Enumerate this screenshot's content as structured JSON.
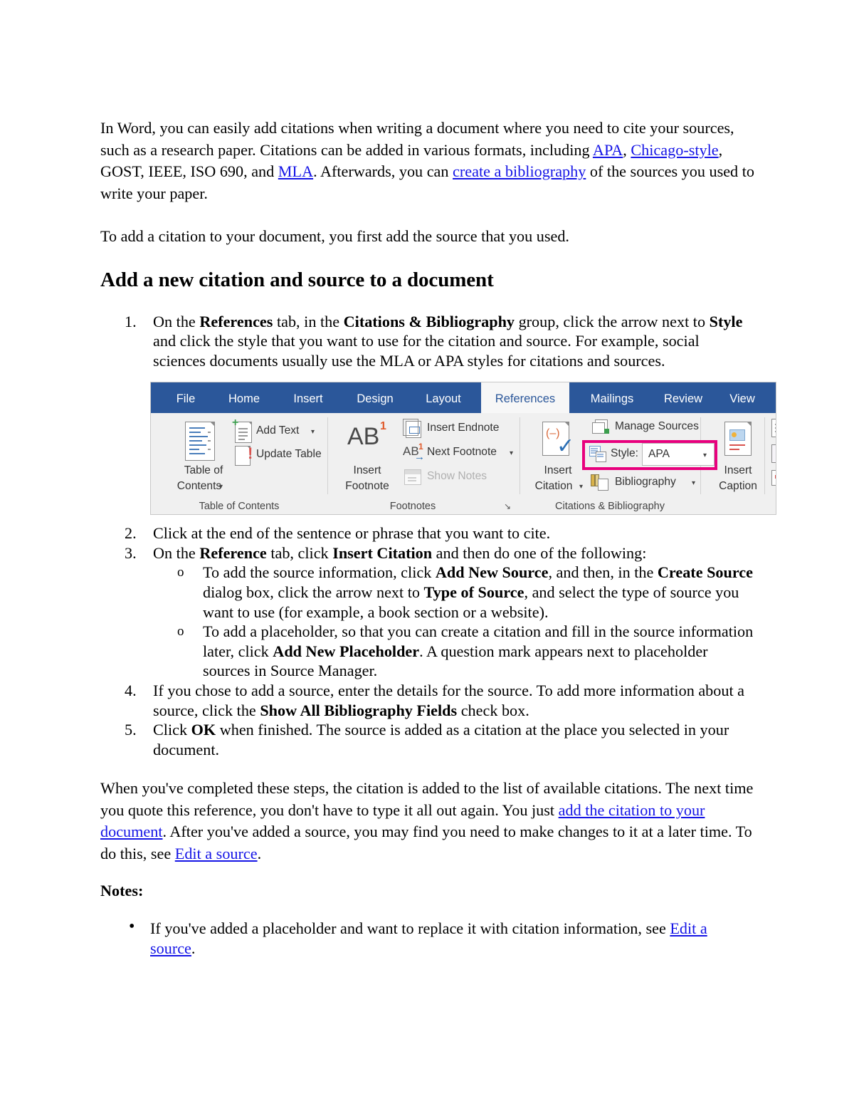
{
  "document": {
    "intro_para": {
      "seg1": "In Word, you can easily add citations when writing a document where you need to cite your sources, such as a research paper. Citations can be added in various formats, including ",
      "link_apa": "APA",
      "seg2": ", ",
      "link_chicago": "Chicago-style",
      "seg3": ", GOST, IEEE, ISO 690, and ",
      "link_mla": "MLA",
      "seg4": ". Afterwards, you can ",
      "link_bibliography": "create a bibliography",
      "seg5": " of the sources you used to write your paper."
    },
    "second_para": "To add a citation to your document, you first add the source that you used.",
    "heading": "Add a new citation and source to a document",
    "steps": [
      {
        "parts": [
          {
            "t": "On the ",
            "b": false
          },
          {
            "t": "References",
            "b": true
          },
          {
            "t": " tab, in the ",
            "b": false
          },
          {
            "t": "Citations & Bibliography",
            "b": true
          },
          {
            "t": " group, click the arrow next to ",
            "b": false
          },
          {
            "t": "Style",
            "b": true
          },
          {
            "t": " and click the style that you want to use for the citation and source. For example, social sciences documents usually use the MLA or APA styles for citations and sources.",
            "b": false
          }
        ]
      },
      {
        "parts": [
          {
            "t": "Click at the end of the sentence or phrase that you want to cite.",
            "b": false
          }
        ]
      },
      {
        "parts": [
          {
            "t": "On the ",
            "b": false
          },
          {
            "t": "Reference",
            "b": true
          },
          {
            "t": " tab, click ",
            "b": false
          },
          {
            "t": "Insert Citation",
            "b": true
          },
          {
            "t": " and then do one of the following:",
            "b": false
          }
        ],
        "sub": [
          {
            "parts": [
              {
                "t": "To add the source information, click ",
                "b": false
              },
              {
                "t": "Add New Source",
                "b": true
              },
              {
                "t": ", and then, in the ",
                "b": false
              },
              {
                "t": "Create Source",
                "b": true
              },
              {
                "t": " dialog box, click the arrow next to ",
                "b": false
              },
              {
                "t": "Type of Source",
                "b": true
              },
              {
                "t": ", and select the type of source you want to use (for example, a book section or a website).",
                "b": false
              }
            ]
          },
          {
            "parts": [
              {
                "t": "To add a placeholder, so that you can create a citation and fill in the source information later, click ",
                "b": false
              },
              {
                "t": "Add New Placeholder",
                "b": true
              },
              {
                "t": ". A question mark appears next to placeholder sources in Source Manager.",
                "b": false
              }
            ]
          }
        ]
      },
      {
        "parts": [
          {
            "t": "If you chose to add a source, enter the details for the source. To add more information about a source, click the ",
            "b": false
          },
          {
            "t": "Show All Bibliography Fields",
            "b": true
          },
          {
            "t": " check box.",
            "b": false
          }
        ]
      },
      {
        "parts": [
          {
            "t": "Click ",
            "b": false
          },
          {
            "t": "OK",
            "b": true
          },
          {
            "t": " when finished. The source is added as a citation at the place you selected in your document.",
            "b": false
          }
        ]
      }
    ],
    "closing_para": {
      "seg1": "When you've completed these steps, the citation is added to the list of available citations. The next time you quote this reference, you don't have to type it all out again. You just ",
      "link_add_citation": "add the citation to your document",
      "seg2": ". After you've added a source, you may find you need to make changes to it at a later time. To do this, see ",
      "link_edit_source": "Edit a source",
      "seg3": "."
    },
    "notes_label": "Notes:",
    "notes": {
      "seg1": "If you've added a placeholder and want to replace it with citation information, see ",
      "link_edit_source": "Edit a source",
      "seg2": "."
    }
  },
  "ribbon": {
    "colors": {
      "tab_bar": "#2B579A",
      "active_tab_bg": "#f7f7f7",
      "body_bg": "#f0f0f0",
      "highlight": "#E8007D",
      "accent_blue": "#4a7ebb",
      "accent_red": "#d9534f"
    },
    "tabs": [
      {
        "label": "File",
        "active": false
      },
      {
        "label": "Home",
        "active": false
      },
      {
        "label": "Insert",
        "active": false
      },
      {
        "label": "Design",
        "active": false
      },
      {
        "label": "Layout",
        "active": false
      },
      {
        "label": "References",
        "active": true
      },
      {
        "label": "Mailings",
        "active": false
      },
      {
        "label": "Review",
        "active": false
      },
      {
        "label": "View",
        "active": false
      }
    ],
    "groups": {
      "toc": {
        "label": "Table of Contents",
        "table_of_contents_line1": "Table of",
        "table_of_contents_line2": "Contents",
        "add_text": "Add Text",
        "update_table": "Update Table"
      },
      "footnotes": {
        "label": "Footnotes",
        "ab_glyph": "AB",
        "ab_sup": "1",
        "insert_footnote_line1": "Insert",
        "insert_footnote_line2": "Footnote",
        "insert_endnote": "Insert Endnote",
        "next_footnote": "Next Footnote",
        "show_notes": "Show Notes",
        "dialog_launcher": "↘"
      },
      "citations": {
        "label": "Citations & Bibliography",
        "insert_citation_line1": "Insert",
        "insert_citation_line2": "Citation",
        "manage_sources": "Manage Sources",
        "style_label": "Style:",
        "style_value": "APA",
        "bibliography": "Bibliography"
      },
      "captions": {
        "insert_caption_line1": "Insert",
        "insert_caption_line2": "Caption"
      }
    }
  }
}
